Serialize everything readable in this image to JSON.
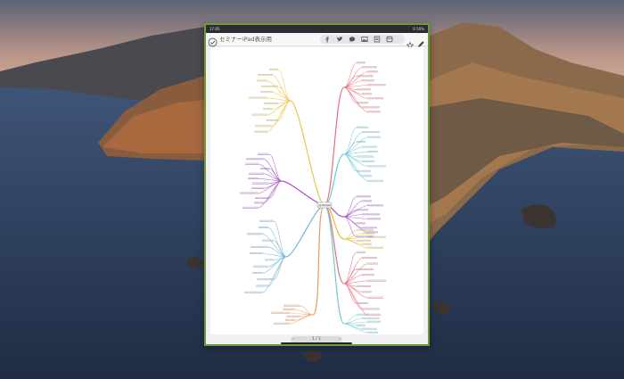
{
  "status": {
    "time": "17:05",
    "date": "2月21日(金)",
    "right": "9 50%"
  },
  "document": {
    "title": "セミナーiPad表示用"
  },
  "toolbar": {
    "share_icons": [
      "facebook-icon",
      "twitter-icon",
      "chat-icon",
      "image-icon",
      "export-icon",
      "layout-icon"
    ],
    "favorite_icon": "star-icon",
    "edit_icon": "pencil-icon"
  },
  "pager": {
    "prev": "‹",
    "label": "1 / 1",
    "next": "›"
  },
  "mindmap": {
    "center_label": "SEMINAR",
    "branch_colors": [
      "#e8c84a",
      "#a852c6",
      "#6ab6d6",
      "#e89a5a",
      "#e6707a",
      "#6cc8d8",
      "#e8b830"
    ]
  },
  "colors": {
    "device_border": "#6f9a3c",
    "sea": "#2d3d55",
    "sky": "#c9a28a"
  }
}
